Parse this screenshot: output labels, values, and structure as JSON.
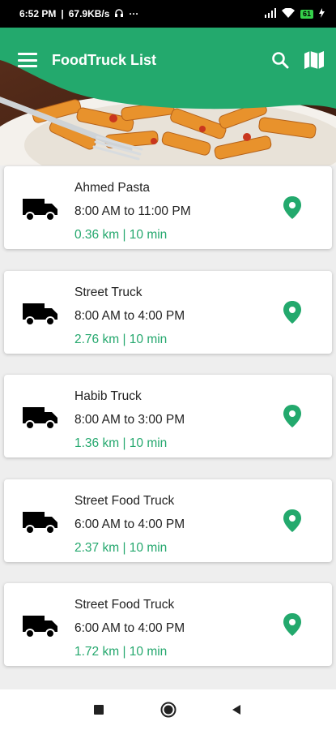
{
  "status_bar": {
    "time": "6:52 PM",
    "network_speed": "67.9KB/s",
    "overflow": "···",
    "battery_level": "61"
  },
  "app_bar": {
    "title": "FoodTruck List",
    "menu_icon": "hamburger-menu-icon",
    "search_icon": "search-icon",
    "map_icon": "map-icon"
  },
  "colors": {
    "primary": "#23a96d",
    "distance_text": "#25a86e",
    "pin": "#23a96d"
  },
  "trucks": [
    {
      "name": "Ahmed Pasta",
      "hours": "8:00 AM to 11:00 PM",
      "distance": "0.36 km | 10 min"
    },
    {
      "name": "Street Truck",
      "hours": "8:00 AM to 4:00 PM",
      "distance": "2.76 km | 10 min"
    },
    {
      "name": "Habib Truck",
      "hours": "8:00 AM to 3:00 PM",
      "distance": "1.36 km | 10 min"
    },
    {
      "name": "Street Food Truck",
      "hours": "6:00 AM to 4:00 PM",
      "distance": "2.37 km | 10 min"
    },
    {
      "name": "Street Food Truck",
      "hours": "6:00 AM to 4:00 PM",
      "distance": "1.72 km | 10 min"
    }
  ],
  "nav_bar": {
    "recents_icon": "square-recents-icon",
    "home_icon": "circle-home-icon",
    "back_icon": "triangle-back-icon"
  }
}
